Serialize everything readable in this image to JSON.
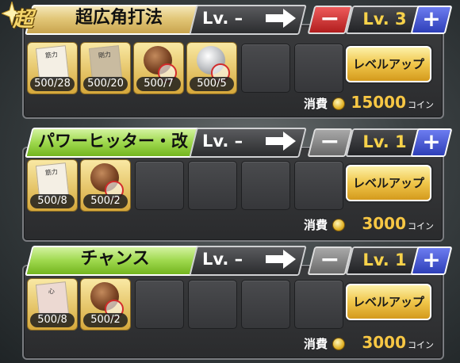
{
  "skills": [
    {
      "badge": "超",
      "name": "超広角打法",
      "current_level": "Lv. –",
      "target_level": "Lv. 3",
      "materials": [
        {
          "label": "筋力",
          "count": "500/28",
          "icon": "paper-card-icon"
        },
        {
          "label": "剛力",
          "count": "500/20",
          "icon": "paper-card-icon"
        },
        {
          "label": "",
          "count": "500/7",
          "icon": "brown-ball-icon"
        },
        {
          "label": "",
          "count": "500/5",
          "icon": "silver-ball-icon"
        }
      ],
      "levelup_label": "レベルアップ",
      "consume_label": "消費",
      "cost": "15000",
      "unit": "コイン",
      "colors": {
        "tab": "#e2c778",
        "minus": "#cf3030"
      }
    },
    {
      "badge": "",
      "name": "パワーヒッター・改",
      "current_level": "Lv. –",
      "target_level": "Lv. 1",
      "materials": [
        {
          "label": "筋力",
          "count": "500/8",
          "icon": "paper-card-icon"
        },
        {
          "label": "",
          "count": "500/2",
          "icon": "brown-ball-icon"
        }
      ],
      "levelup_label": "レベルアップ",
      "consume_label": "消費",
      "cost": "3000",
      "unit": "コイン",
      "colors": {
        "tab": "#9ed84d",
        "minus": "#8a8a8a"
      }
    },
    {
      "badge": "",
      "name": "チャンス",
      "current_level": "Lv. –",
      "target_level": "Lv. 1",
      "materials": [
        {
          "label": "心",
          "count": "500/8",
          "icon": "paper-card-icon"
        },
        {
          "label": "",
          "count": "500/2",
          "icon": "brown-ball-icon"
        }
      ],
      "levelup_label": "レベルアップ",
      "consume_label": "消費",
      "cost": "3000",
      "unit": "コイン",
      "colors": {
        "tab": "#9ed84d",
        "minus": "#8a8a8a"
      }
    }
  ]
}
